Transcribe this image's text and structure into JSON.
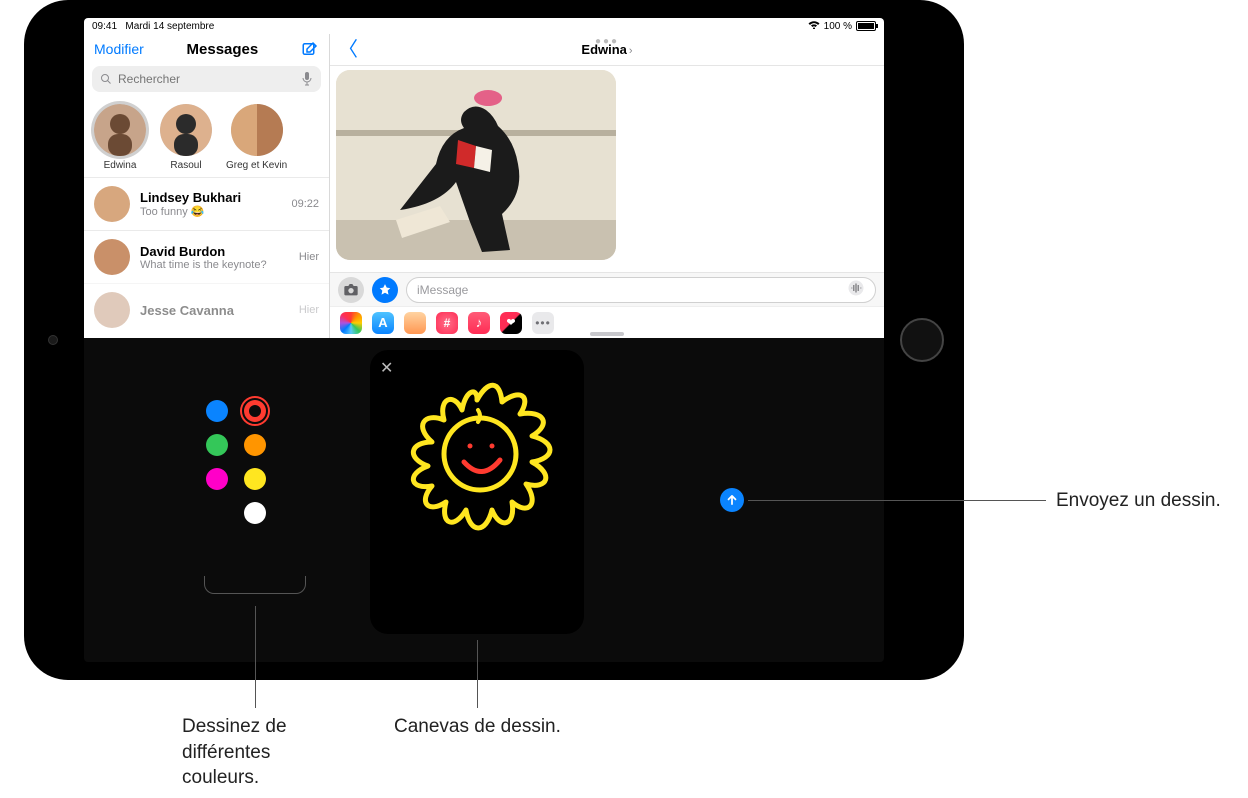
{
  "status": {
    "time": "09:41",
    "date": "Mardi 14 septembre",
    "battery_pct": "100 %",
    "battery_icon": "battery-full"
  },
  "sidebar": {
    "edit": "Modifier",
    "title": "Messages",
    "search_placeholder": "Rechercher",
    "pins": [
      {
        "name": "Edwina",
        "selected": true
      },
      {
        "name": "Rasoul",
        "selected": false
      },
      {
        "name": "Greg et Kevin",
        "selected": false
      }
    ],
    "rows": [
      {
        "name": "Lindsey Bukhari",
        "preview": "Too funny 😂",
        "time": "09:22"
      },
      {
        "name": "David Burdon",
        "preview": "What time is the keynote?",
        "time": "Hier"
      },
      {
        "name": "Jesse Cavanna",
        "preview": "",
        "time": "Hier"
      }
    ]
  },
  "chat": {
    "contact": "Edwina",
    "input_placeholder": "iMessage"
  },
  "app_strip": {
    "icons": [
      {
        "id": "photos-app-icon",
        "bg": "conic-gradient(#ff3b30,#ff9500,#ffcc00,#34c759,#5ac8fa,#007aff,#af52de,#ff2d55,#ff3b30)"
      },
      {
        "id": "appstore-app-icon",
        "bg": "linear-gradient(180deg,#4fc3ff,#0a84ff)",
        "glyph": "A"
      },
      {
        "id": "memoji-app-icon",
        "bg": "linear-gradient(180deg,#ffd3a1,#ff9752)"
      },
      {
        "id": "findmy-app-icon",
        "bg": "radial-gradient(circle,#ff5b77,#ff2d55)"
      },
      {
        "id": "music-app-icon",
        "bg": "linear-gradient(180deg,#ff5b77,#ff2d55)",
        "glyph": "♪"
      },
      {
        "id": "digitaltouch-app-icon",
        "bg": "linear-gradient(135deg,#ff2d55,#000 55%)",
        "glyph": "❤"
      }
    ]
  },
  "drawer": {
    "colors_left": [
      "#0a84ff",
      "#34c759",
      "#ff00c8"
    ],
    "colors_right": [
      "#ff3b30",
      "#ff9500",
      "#ffe620",
      "#ffffff"
    ],
    "selected_color": "#ff3b30",
    "canvas_drawing": "sun-smile"
  },
  "callouts": {
    "send": "Envoyez un dessin.",
    "colors": "Dessinez de différentes couleurs.",
    "canvas": "Canevas de dessin."
  }
}
